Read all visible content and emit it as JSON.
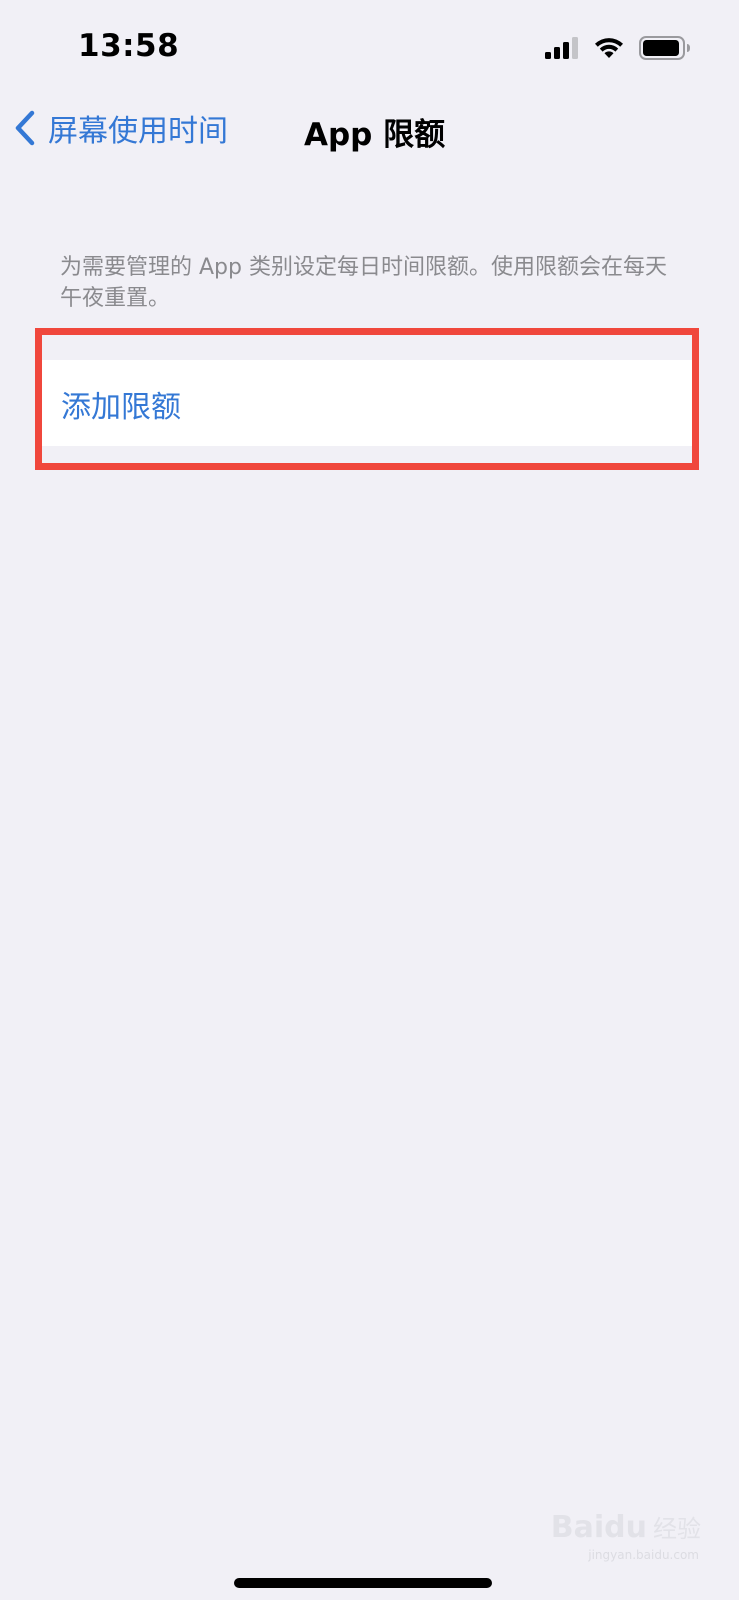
{
  "status_bar": {
    "time": "13:58"
  },
  "nav": {
    "back_label": "屏幕使用时间",
    "title": "App 限额"
  },
  "content": {
    "description": "为需要管理的 App 类别设定每日时间限额。使用限额会在每天午夜重置。",
    "add_limit_label": "添加限额"
  },
  "watermark": {
    "brand": "Baidu",
    "cn": "经验",
    "url": "jingyan.baidu.com"
  },
  "colors": {
    "accent": "#3478d5",
    "background": "#f1f0f6",
    "highlight": "#f0473c"
  }
}
